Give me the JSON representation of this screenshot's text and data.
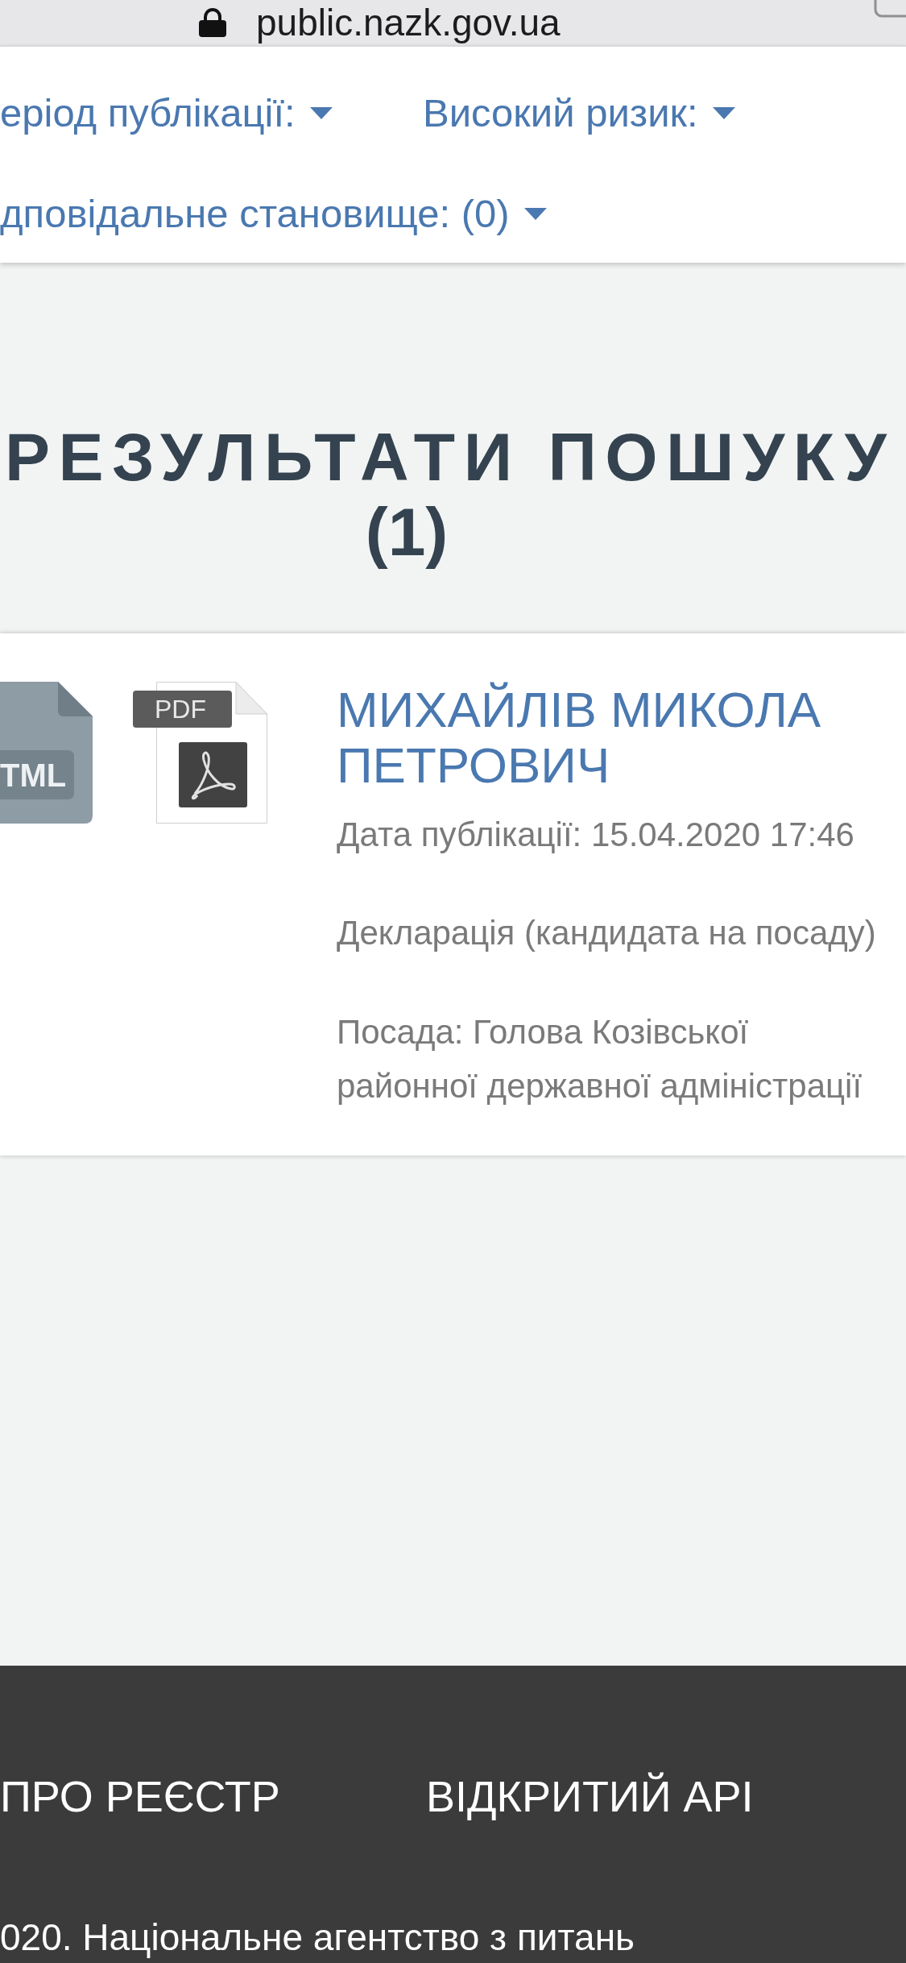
{
  "browser_bar": {
    "url": "public.nazk.gov.ua"
  },
  "filters": [
    {
      "label": "еріод публікації:"
    },
    {
      "label": "Високий ризик:"
    },
    {
      "label": "дповідальне становище: (0)"
    }
  ],
  "results_heading": {
    "title": "РЕЗУЛЬТАТИ ПОШУКУ",
    "count": "(1)"
  },
  "results": [
    {
      "file_icons": [
        {
          "kind": "html",
          "label": "TML"
        },
        {
          "kind": "pdf",
          "label": "PDF"
        }
      ],
      "name": "МИХАЙЛІВ МИКОЛА ПЕТРОВИЧ",
      "published": "Дата публікації: 15.04.2020 17:46",
      "declaration_type": "Декларація (кандидата на посаду)",
      "position": "Посада: Голова Козівської районної державної адміністрації"
    }
  ],
  "footer": {
    "links": [
      "ПРО РЕЄСТР",
      "ВІДКРИТИЙ API"
    ],
    "copyright": "020. Національне агентство з питань"
  }
}
